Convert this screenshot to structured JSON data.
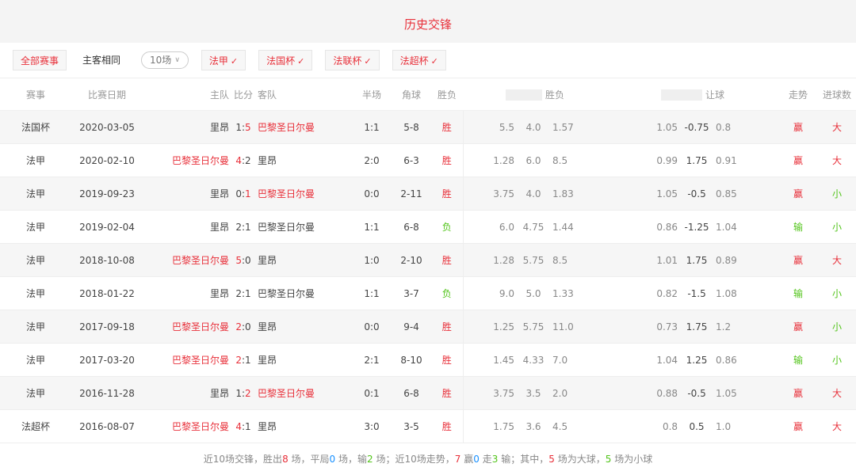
{
  "title": "历史交锋",
  "filters": {
    "all": "全部赛事",
    "same_home": "主客相同",
    "count": "10场",
    "leagues": [
      "法甲",
      "法国杯",
      "法联杯",
      "法超杯"
    ]
  },
  "headers": {
    "event": "赛事",
    "date": "比赛日期",
    "home": "主队",
    "score": "比分",
    "away": "客队",
    "half": "半场",
    "corner": "角球",
    "result": "胜负",
    "odds_result": "胜负",
    "handicap": "让球",
    "trend": "走势",
    "goals": "进球数"
  },
  "rows": [
    {
      "event": "法国杯",
      "date": "2020-03-05",
      "home": "里昂",
      "home_red": false,
      "hs": "1",
      "as": "5",
      "away": "巴黎圣日尔曼",
      "away_red": true,
      "hs_red": false,
      "as_red": true,
      "half": "1:1",
      "corner": "5-8",
      "res": "胜",
      "o1": "5.5",
      "o2": "4.0",
      "o3": "1.57",
      "h1": "1.05",
      "h2": "-0.75",
      "h3": "0.8",
      "trend": "赢",
      "goal": "大"
    },
    {
      "event": "法甲",
      "date": "2020-02-10",
      "home": "巴黎圣日尔曼",
      "home_red": true,
      "hs": "4",
      "as": "2",
      "away": "里昂",
      "away_red": false,
      "hs_red": true,
      "as_red": false,
      "half": "2:0",
      "corner": "6-3",
      "res": "胜",
      "o1": "1.28",
      "o2": "6.0",
      "o3": "8.5",
      "h1": "0.99",
      "h2": "1.75",
      "h3": "0.91",
      "trend": "赢",
      "goal": "大"
    },
    {
      "event": "法甲",
      "date": "2019-09-23",
      "home": "里昂",
      "home_red": false,
      "hs": "0",
      "as": "1",
      "away": "巴黎圣日尔曼",
      "away_red": true,
      "hs_red": false,
      "as_red": true,
      "half": "0:0",
      "corner": "2-11",
      "res": "胜",
      "o1": "3.75",
      "o2": "4.0",
      "o3": "1.83",
      "h1": "1.05",
      "h2": "-0.5",
      "h3": "0.85",
      "trend": "赢",
      "goal": "小"
    },
    {
      "event": "法甲",
      "date": "2019-02-04",
      "home": "里昂",
      "home_red": false,
      "hs": "2",
      "as": "1",
      "away": "巴黎圣日尔曼",
      "away_red": false,
      "hs_red": false,
      "as_red": false,
      "half": "1:1",
      "corner": "6-8",
      "res": "负",
      "o1": "6.0",
      "o2": "4.75",
      "o3": "1.44",
      "h1": "0.86",
      "h2": "-1.25",
      "h3": "1.04",
      "trend": "输",
      "goal": "小"
    },
    {
      "event": "法甲",
      "date": "2018-10-08",
      "home": "巴黎圣日尔曼",
      "home_red": true,
      "hs": "5",
      "as": "0",
      "away": "里昂",
      "away_red": false,
      "hs_red": true,
      "as_red": false,
      "half": "1:0",
      "corner": "2-10",
      "res": "胜",
      "o1": "1.28",
      "o2": "5.75",
      "o3": "8.5",
      "h1": "1.01",
      "h2": "1.75",
      "h3": "0.89",
      "trend": "赢",
      "goal": "大"
    },
    {
      "event": "法甲",
      "date": "2018-01-22",
      "home": "里昂",
      "home_red": false,
      "hs": "2",
      "as": "1",
      "away": "巴黎圣日尔曼",
      "away_red": false,
      "hs_red": false,
      "as_red": false,
      "half": "1:1",
      "corner": "3-7",
      "res": "负",
      "o1": "9.0",
      "o2": "5.0",
      "o3": "1.33",
      "h1": "0.82",
      "h2": "-1.5",
      "h3": "1.08",
      "trend": "输",
      "goal": "小"
    },
    {
      "event": "法甲",
      "date": "2017-09-18",
      "home": "巴黎圣日尔曼",
      "home_red": true,
      "hs": "2",
      "as": "0",
      "away": "里昂",
      "away_red": false,
      "hs_red": true,
      "as_red": false,
      "half": "0:0",
      "corner": "9-4",
      "res": "胜",
      "o1": "1.25",
      "o2": "5.75",
      "o3": "11.0",
      "h1": "0.73",
      "h2": "1.75",
      "h3": "1.2",
      "trend": "赢",
      "goal": "小"
    },
    {
      "event": "法甲",
      "date": "2017-03-20",
      "home": "巴黎圣日尔曼",
      "home_red": true,
      "hs": "2",
      "as": "1",
      "away": "里昂",
      "away_red": false,
      "hs_red": true,
      "as_red": false,
      "half": "2:1",
      "corner": "8-10",
      "res": "胜",
      "o1": "1.45",
      "o2": "4.33",
      "o3": "7.0",
      "h1": "1.04",
      "h2": "1.25",
      "h3": "0.86",
      "trend": "输",
      "goal": "小"
    },
    {
      "event": "法甲",
      "date": "2016-11-28",
      "home": "里昂",
      "home_red": false,
      "hs": "1",
      "as": "2",
      "away": "巴黎圣日尔曼",
      "away_red": true,
      "hs_red": false,
      "as_red": true,
      "half": "0:1",
      "corner": "6-8",
      "res": "胜",
      "o1": "3.75",
      "o2": "3.5",
      "o3": "2.0",
      "h1": "0.88",
      "h2": "-0.5",
      "h3": "1.05",
      "trend": "赢",
      "goal": "大"
    },
    {
      "event": "法超杯",
      "date": "2016-08-07",
      "home": "巴黎圣日尔曼",
      "home_red": true,
      "hs": "4",
      "as": "1",
      "away": "里昂",
      "away_red": false,
      "hs_red": true,
      "as_red": false,
      "half": "3:0",
      "corner": "3-5",
      "res": "胜",
      "o1": "1.75",
      "o2": "3.6",
      "o3": "4.5",
      "h1": "0.8",
      "h2": "0.5",
      "h3": "1.0",
      "trend": "赢",
      "goal": "大"
    }
  ],
  "summary": {
    "p1": "近10场交锋，胜出",
    "win": "8",
    "p2": "场，平局",
    "draw": "0",
    "p3": "场，输",
    "lose": "2",
    "p4": "场；近10场走势，",
    "tw": "7",
    "p5": "赢",
    "td": "0",
    "p6": "走",
    "tl": "3",
    "p7": "输；其中，",
    "big": "5",
    "p8": "场为大球，",
    "small": "5",
    "p9": "场为小球"
  },
  "colors": {
    "accent": "#e8303a",
    "win": "#e8303a",
    "lose": "#52c41a",
    "draw": "#1890ff"
  }
}
